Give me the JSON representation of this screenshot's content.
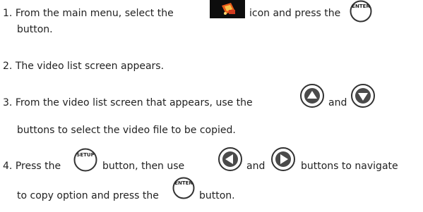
{
  "steps": [
    {
      "num": "1.",
      "text_a": "From the main menu, select the",
      "text_b": "icon and press the",
      "text_c": "button."
    },
    {
      "num": "2.",
      "text_a": "The video list screen appears."
    },
    {
      "num": "3.",
      "text_a": "From the video list screen that appears, use the",
      "text_b": "and",
      "text_c": "buttons to select the video file to be copied."
    },
    {
      "num": "4.",
      "text_a": "Press the",
      "text_b": "button, then use",
      "text_c": "and",
      "text_d": "buttons to navigate",
      "text_e": "to copy option and press the",
      "text_f": "button."
    }
  ],
  "buttons": {
    "enter_label": "ENTER",
    "setup_label": "SETUP"
  },
  "icons": {
    "video": "video-menu-icon",
    "enter": "enter-button-icon",
    "up": "up-arrow-button-icon",
    "down": "down-arrow-button-icon",
    "setup": "setup-button-icon",
    "left": "left-arrow-button-icon",
    "right": "right-arrow-button-icon"
  }
}
